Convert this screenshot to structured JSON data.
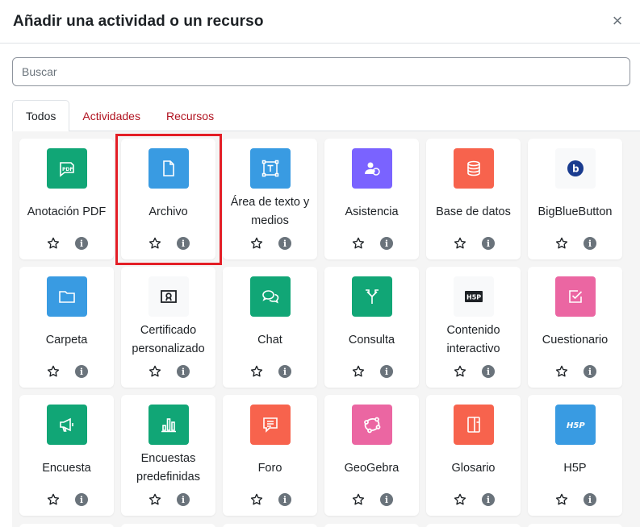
{
  "modal": {
    "title": "Añadir una actividad o un recurso",
    "close_label": "×"
  },
  "search": {
    "placeholder": "Buscar",
    "value": ""
  },
  "tabs": [
    {
      "label": "Todos",
      "active": true
    },
    {
      "label": "Actividades",
      "active": false
    },
    {
      "label": "Recursos",
      "active": false
    }
  ],
  "colors": {
    "green": "#11a676",
    "blue": "#399be2",
    "purple": "#7a63ff",
    "orange": "#f7634d",
    "pink": "#eb66a2",
    "dark": "#1d2125",
    "link_red": "#b0121f",
    "highlight": "#e31e26"
  },
  "items": [
    {
      "name": "anotacion-pdf",
      "label": "Anotación PDF",
      "color": "#11a676",
      "icon": "pdf-annotation-icon"
    },
    {
      "name": "archivo",
      "label": "Archivo",
      "color": "#399be2",
      "icon": "file-icon",
      "highlighted": true
    },
    {
      "name": "area-texto",
      "label": "Área de texto y medios",
      "color": "#399be2",
      "icon": "text-area-icon"
    },
    {
      "name": "asistencia",
      "label": "Asistencia",
      "color": "#7a63ff",
      "icon": "attendance-icon"
    },
    {
      "name": "base-datos",
      "label": "Base de datos",
      "color": "#f7634d",
      "icon": "database-icon"
    },
    {
      "name": "bigbluebutton",
      "label": "BigBlueButton",
      "color": "#f8f9fa",
      "icon": "bigbluebutton-icon"
    },
    {
      "name": "carpeta",
      "label": "Carpeta",
      "color": "#399be2",
      "icon": "folder-icon"
    },
    {
      "name": "certificado",
      "label": "Certificado personalizado",
      "color": "#f8f9fa",
      "icon": "certificate-icon"
    },
    {
      "name": "chat",
      "label": "Chat",
      "color": "#11a676",
      "icon": "chat-icon"
    },
    {
      "name": "consulta",
      "label": "Consulta",
      "color": "#11a676",
      "icon": "choice-icon"
    },
    {
      "name": "contenido-interactivo",
      "label": "Contenido interactivo",
      "color": "#f8f9fa",
      "icon": "h5p-dark-icon"
    },
    {
      "name": "cuestionario",
      "label": "Cuestionario",
      "color": "#eb66a2",
      "icon": "quiz-icon"
    },
    {
      "name": "encuesta",
      "label": "Encuesta",
      "color": "#11a676",
      "icon": "survey-icon"
    },
    {
      "name": "encuestas-predefinidas",
      "label": "Encuestas predefinidas",
      "color": "#11a676",
      "icon": "bar-chart-icon"
    },
    {
      "name": "foro",
      "label": "Foro",
      "color": "#f7634d",
      "icon": "forum-icon"
    },
    {
      "name": "geogebra",
      "label": "GeoGebra",
      "color": "#eb66a2",
      "icon": "geogebra-icon"
    },
    {
      "name": "glosario",
      "label": "Glosario",
      "color": "#f7634d",
      "icon": "glossary-icon"
    },
    {
      "name": "h5p",
      "label": "H5P",
      "color": "#399be2",
      "icon": "h5p-icon"
    }
  ]
}
